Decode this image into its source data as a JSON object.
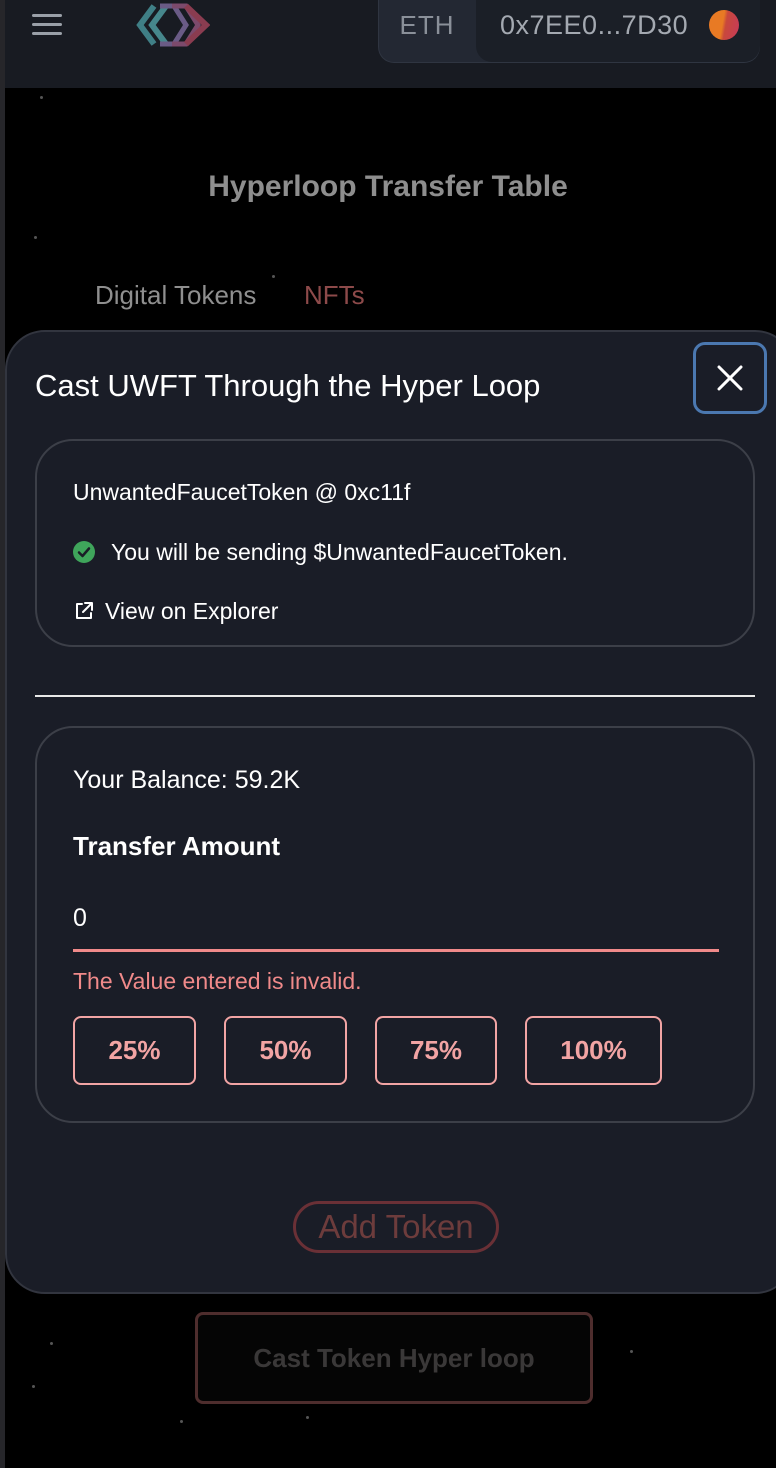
{
  "header": {
    "menu_icon": "hamburger-menu-icon",
    "logo_icon": "hyperloop-logo",
    "network": "ETH",
    "address": "0x7EE0...7D30"
  },
  "page": {
    "title": "Hyperloop Transfer Table",
    "tabs": [
      {
        "label": "Digital Tokens",
        "active": false
      },
      {
        "label": "NFTs",
        "active": true
      }
    ],
    "cast_button": "Cast Token Hyper loop"
  },
  "modal": {
    "title": "Cast UWFT Through the Hyper Loop",
    "close_icon": "close-icon",
    "token_info": {
      "name": "UnwantedFaucetToken @ 0xc11f",
      "status": "You will be sending $UnwantedFaucetToken.",
      "explorer_link": "View on Explorer"
    },
    "amount": {
      "balance": "Your Balance: 59.2K",
      "label": "Transfer Amount",
      "value": "0",
      "error": "The Value entered is invalid.",
      "percent_buttons": [
        "25%",
        "50%",
        "75%",
        "100%"
      ]
    },
    "add_token": "Add Token"
  },
  "colors": {
    "background": "#000000",
    "modal_bg": "#1a1d27",
    "accent_error": "#f08a8a",
    "success": "#3fa55b",
    "close_border": "#4b78b0"
  }
}
